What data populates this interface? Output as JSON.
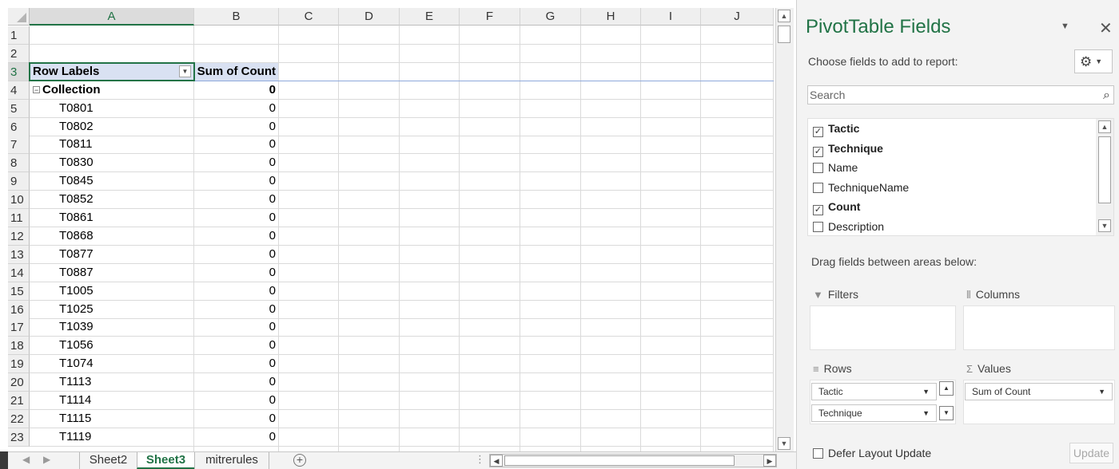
{
  "columns": [
    "A",
    "B",
    "C",
    "D",
    "E",
    "F",
    "G",
    "H",
    "I",
    "J"
  ],
  "rows": [
    {
      "num": "1",
      "a": "",
      "b": ""
    },
    {
      "num": "2",
      "a": "",
      "b": ""
    },
    {
      "num": "3",
      "a": "Row Labels",
      "b": "Sum of Count"
    },
    {
      "num": "4",
      "a": "Collection",
      "b": "0"
    },
    {
      "num": "5",
      "a": "T0801",
      "b": "0"
    },
    {
      "num": "6",
      "a": "T0802",
      "b": "0"
    },
    {
      "num": "7",
      "a": "T0811",
      "b": "0"
    },
    {
      "num": "8",
      "a": "T0830",
      "b": "0"
    },
    {
      "num": "9",
      "a": "T0845",
      "b": "0"
    },
    {
      "num": "10",
      "a": "T0852",
      "b": "0"
    },
    {
      "num": "11",
      "a": "T0861",
      "b": "0"
    },
    {
      "num": "12",
      "a": "T0868",
      "b": "0"
    },
    {
      "num": "13",
      "a": "T0877",
      "b": "0"
    },
    {
      "num": "14",
      "a": "T0887",
      "b": "0"
    },
    {
      "num": "15",
      "a": "T1005",
      "b": "0"
    },
    {
      "num": "16",
      "a": "T1025",
      "b": "0"
    },
    {
      "num": "17",
      "a": "T1039",
      "b": "0"
    },
    {
      "num": "18",
      "a": "T1056",
      "b": "0"
    },
    {
      "num": "19",
      "a": "T1074",
      "b": "0"
    },
    {
      "num": "20",
      "a": "T1113",
      "b": "0"
    },
    {
      "num": "21",
      "a": "T1114",
      "b": "0"
    },
    {
      "num": "22",
      "a": "T1115",
      "b": "0"
    },
    {
      "num": "23",
      "a": "T1119",
      "b": "0"
    }
  ],
  "tabs": [
    "Sheet2",
    "Sheet3",
    "mitrerules"
  ],
  "active_tab": "Sheet3",
  "pivot": {
    "title": "PivotTable Fields",
    "choose_label": "Choose fields to add to report:",
    "search_placeholder": "Search",
    "fields": [
      {
        "label": "Tactic",
        "checked": true
      },
      {
        "label": "Technique",
        "checked": true
      },
      {
        "label": "Name",
        "checked": false
      },
      {
        "label": "TechniqueName",
        "checked": false
      },
      {
        "label": "Count",
        "checked": true
      },
      {
        "label": "Description",
        "checked": false
      }
    ],
    "drag_label": "Drag fields between areas below:",
    "filters_label": "Filters",
    "columns_label": "Columns",
    "rows_label": "Rows",
    "values_label": "Values",
    "rows_items": [
      "Tactic",
      "Technique"
    ],
    "values_items": [
      "Sum of Count"
    ],
    "defer_label": "Defer Layout Update",
    "update_label": "Update"
  },
  "colors": {
    "accent": "#217346",
    "header_fill": "#d9e1f2"
  }
}
